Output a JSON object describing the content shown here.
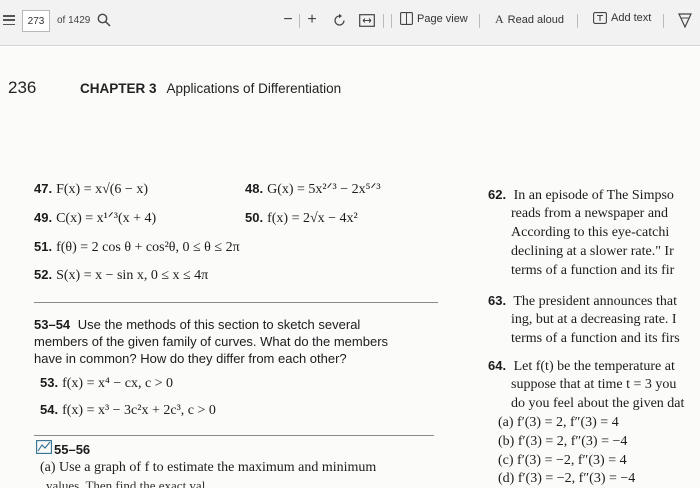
{
  "toolbar": {
    "page_number": "273",
    "page_total": "of 1429",
    "minus": "−",
    "plus": "+",
    "page_view": "Page view",
    "read_aloud": "Read aloud",
    "add_text": "Add text",
    "read_aloud_glyph": "A",
    "icons": [
      "menu-icon",
      "search-icon",
      "rotate-icon",
      "fit-page-icon",
      "page-view-icon",
      "read-aloud-icon",
      "add-text-icon",
      "highlight-icon"
    ]
  },
  "page": {
    "number": "236",
    "chapter": "CHAPTER 3",
    "chapter_title": "Applications of Differentiation",
    "left": {
      "ex47": {
        "num": "47.",
        "text": "F(x) = x√(6 − x)"
      },
      "ex48": {
        "num": "48.",
        "text": "G(x) = 5x²ᐟ³ − 2x⁵ᐟ³"
      },
      "ex49": {
        "num": "49.",
        "text": "C(x) = x¹ᐟ³(x + 4)"
      },
      "ex50": {
        "num": "50.",
        "text": "f(x) = 2√x − 4x²"
      },
      "ex51": {
        "num": "51.",
        "text": "f(θ) = 2 cos θ + cos²θ,   0 ≤ θ ≤ 2π"
      },
      "ex52": {
        "num": "52.",
        "text": "S(x) = x − sin x,   0 ≤ x ≤ 4π"
      },
      "sec53": {
        "num": "53–54",
        "line1": "Use the methods of this section to sketch several",
        "line2": "members of the given family of curves. What do the members",
        "line3": "have in common? How do they differ from each other?"
      },
      "ex53": {
        "num": "53.",
        "text": "f(x) = x⁴ − cx,   c > 0"
      },
      "ex54": {
        "num": "54.",
        "text": "f(x) = x³ − 3c²x + 2c³,   c > 0"
      },
      "sec55": {
        "num": "55–56",
        "line1": "(a) Use a graph of f to estimate the maximum and minimum",
        "line2": "values. Then find the exact val"
      }
    },
    "right": {
      "ex62": {
        "num": "62.",
        "l1": "In an episode of The Simpso",
        "l2": "reads from a newspaper and",
        "l3": "According to this eye-catchi",
        "l4": "declining at a slower rate.\" Ir",
        "l5": "terms of a function and its fir"
      },
      "ex63": {
        "num": "63.",
        "l1": "The president announces that",
        "l2": "ing, but at a decreasing rate. I",
        "l3": "terms of a function and its firs"
      },
      "ex64": {
        "num": "64.",
        "l1": "Let f(t) be the temperature at",
        "l2": "suppose that at time t = 3 you",
        "l3": "do you feel about the given dat",
        "a": "(a) f′(3) = 2,   f″(3) = 4",
        "b": "(b) f′(3) = 2,   f″(3) = −4",
        "c": "(c) f′(3) = −2,   f″(3) = 4",
        "d": "(d) f′(3) = −2,   f″(3) = −4"
      }
    }
  }
}
